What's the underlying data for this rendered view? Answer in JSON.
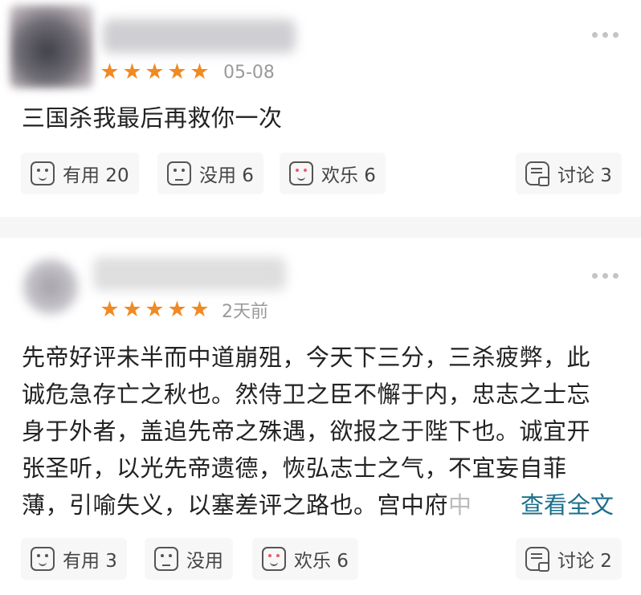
{
  "reviews": [
    {
      "rating": 5,
      "date": "05-08",
      "text": [
        "三国杀我最后再救你一次"
      ],
      "actions": {
        "useful": "有用 20",
        "useless": "没用 6",
        "fun": "欢乐 6",
        "discuss": "讨论 3"
      }
    },
    {
      "rating": 5,
      "date": "2天前",
      "text": [
        "先帝好评未半而中道崩殂，今天下三分，三杀疲弊，此",
        "诚危急存亡之秋也。然侍卫之臣不懈于内，忠志之士忘",
        "身于外者，盖追先帝之殊遇，欲报之于陛下也。诚宜开",
        "张圣听，以光先帝遗德，恢弘志士之气，不宜妄自菲",
        "薄，引喻失义，以塞差评之路也。宫中府"
      ],
      "faded_tail": "中",
      "read_more": "查看全文",
      "actions": {
        "useful": "有用 3",
        "useless": "没用",
        "fun": "欢乐 6",
        "discuss": "讨论 2"
      }
    }
  ],
  "star_glyph": "★",
  "colors": {
    "star": "#f08a24",
    "link": "#1a6f8a",
    "date": "#9a9a9a"
  },
  "icons": [
    "more-dots-icon",
    "star-icon",
    "useful-face-icon",
    "useless-face-icon",
    "fun-face-icon",
    "discuss-bubble-icon"
  ]
}
